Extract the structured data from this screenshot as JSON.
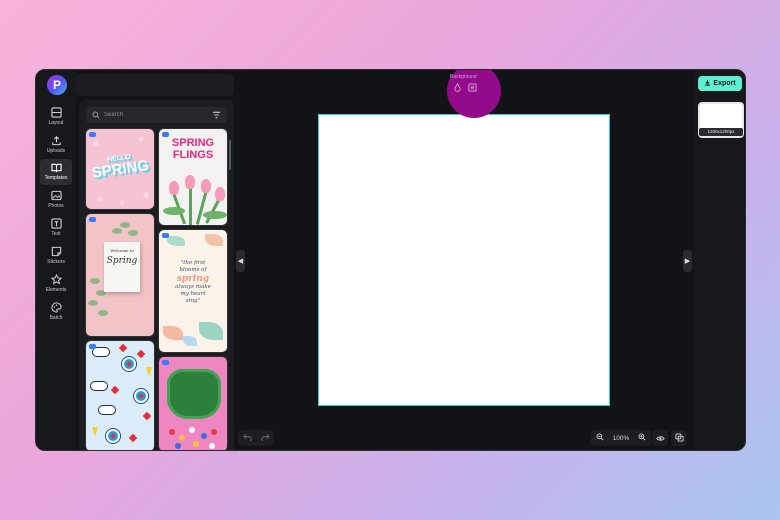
{
  "sidebar": {
    "logo": "P",
    "items": [
      {
        "label": "Layout",
        "icon": "layout-icon"
      },
      {
        "label": "Uploads",
        "icon": "upload-icon"
      },
      {
        "label": "Templates",
        "icon": "book-icon",
        "active": true
      },
      {
        "label": "Photos",
        "icon": "image-icon"
      },
      {
        "label": "Text",
        "icon": "text-icon"
      },
      {
        "label": "Stickers",
        "icon": "sticker-icon"
      },
      {
        "label": "Elements",
        "icon": "star-icon"
      },
      {
        "label": "Batch",
        "icon": "palette-icon"
      }
    ]
  },
  "templates_panel": {
    "search_placeholder": "Search",
    "templates": [
      {
        "name": "hello-spring",
        "text_line1": "HELLO",
        "text_line2": "SPRING"
      },
      {
        "name": "spring-flings",
        "text_line1": "SPRING",
        "text_line2": "FLINGS"
      },
      {
        "name": "welcome-spring-card",
        "text_line1": "Welcome to",
        "text_line2": "Spring"
      },
      {
        "name": "first-blooms-quote",
        "text_line1": "\"the first",
        "text_line2": "blooms of",
        "text_line3": "spring",
        "text_line4": "always make",
        "text_line5": "my heart",
        "text_line6": "sing\""
      },
      {
        "name": "flower-cloud-pattern"
      },
      {
        "name": "green-blob-flowers"
      }
    ]
  },
  "toolbar": {
    "background_label": "Background"
  },
  "zoom": {
    "level": "100%",
    "minus": "−",
    "plus": "+"
  },
  "export": {
    "label": "Export"
  },
  "page_thumb": {
    "size_label": "1200x1200px"
  },
  "colors": {
    "accent": "#5ff0d2",
    "canvas_border": "#3fd6b8",
    "highlight": "#930a8a"
  }
}
